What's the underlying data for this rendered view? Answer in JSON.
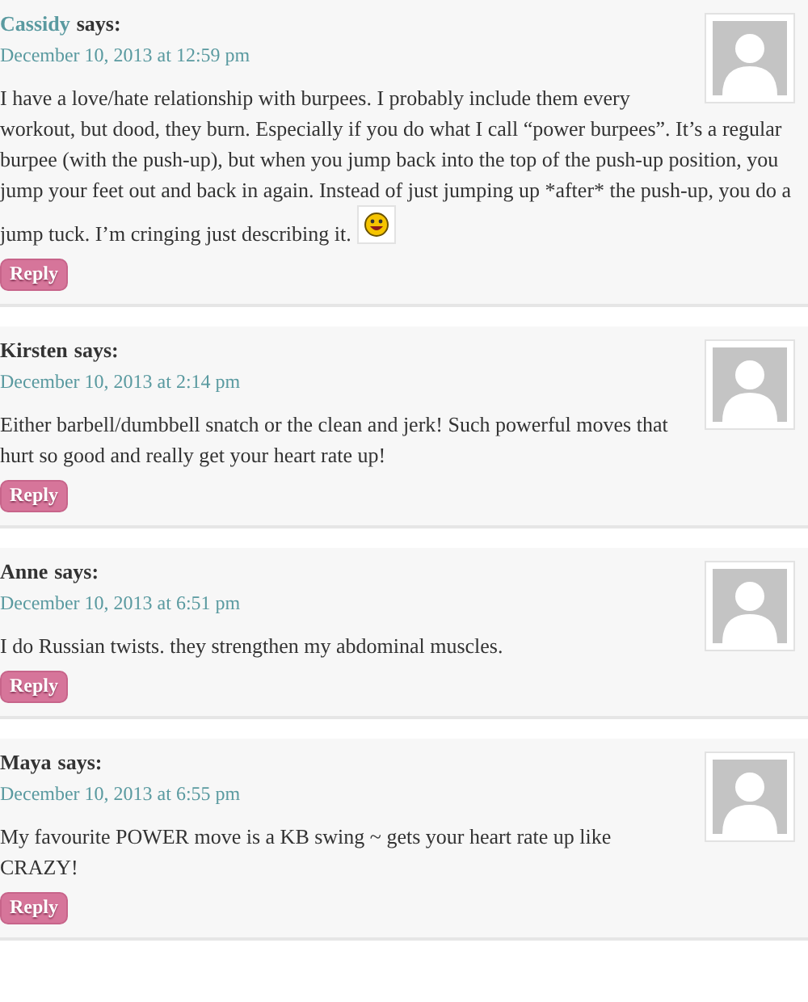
{
  "comments": [
    {
      "author": "Cassidy",
      "linked": true,
      "says": "says:",
      "date": "December 10, 2013 at 12:59 pm",
      "text": "I have a love/hate relationship with burpees. I probably include them every workout, but dood, they burn. Especially if you do what I call “power burpees”. It’s a regular burpee (with the push-up), but when you jump back into the top of the push-up position, you jump your feet out and back in again. Instead of just jumping up *after* the push-up, you do a jump tuck. I’m cringing just describing it.",
      "emoticon": true,
      "reply": "Reply"
    },
    {
      "author": "Kirsten",
      "linked": false,
      "says": "says:",
      "date": "December 10, 2013 at 2:14 pm",
      "text": "Either barbell/dumbbell snatch or the clean and jerk! Such powerful moves that hurt so good and really get your heart rate up!",
      "emoticon": false,
      "reply": "Reply"
    },
    {
      "author": "Anne",
      "linked": false,
      "says": "says:",
      "date": "December 10, 2013 at 6:51 pm",
      "text": "I do Russian twists. they strengthen my abdominal muscles.",
      "emoticon": false,
      "reply": "Reply"
    },
    {
      "author": "Maya",
      "linked": false,
      "says": "says:",
      "date": "December 10, 2013 at 6:55 pm",
      "text": "My favourite POWER move is a KB swing ~ gets your heart rate up like CRAZY!",
      "emoticon": false,
      "reply": "Reply"
    }
  ]
}
